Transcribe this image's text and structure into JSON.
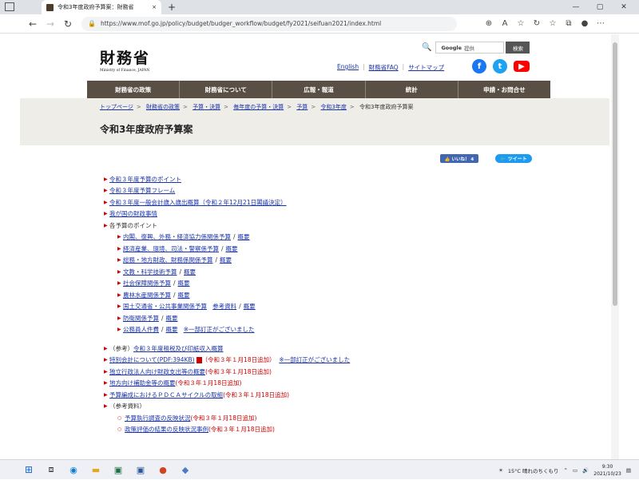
{
  "browser": {
    "tab_title": "令和3年度政府予算案：財務省",
    "tab_close": "×",
    "new_tab": "+",
    "url": "https://www.mof.go.jp/policy/budget/budger_workflow/budget/fy2021/seifuan2021/index.html",
    "minimize": "—",
    "maximize": "▢",
    "close": "✕"
  },
  "header": {
    "logo_jp": "財務省",
    "logo_en": "Ministry of Finance, JAPAN",
    "search_brand": "Google",
    "search_placeholder": "提供",
    "search_button": "検索",
    "util_links": [
      "English",
      "財務省FAQ",
      "サイトマップ"
    ],
    "util_sep": "|"
  },
  "main_nav": [
    "財務省の政策",
    "財務省について",
    "広報・報道",
    "統計",
    "申請・お問合せ"
  ],
  "breadcrumb": [
    "トップページ",
    "財務省の政策",
    "予算・決算",
    "毎年度の予算・決算",
    "予算",
    "令和3年度",
    "令和3年度政府予算案"
  ],
  "page_title": "令和3年度政府予算案",
  "sns": {
    "like": "👍 いいね！ 4",
    "tweet": "🐦 ツイート"
  },
  "links": {
    "top": [
      "令和３年度予算のポイント",
      "令和３年度予算フレーム",
      "令和３年度一般会計歳入歳出概算（令和２年12月21日閣議決定）",
      "我が国の財政事情"
    ],
    "points_heading": "各予算のポイント",
    "points": [
      {
        "main": "内閣、復興、外務・経済協力係関係予算",
        "summary": "概要"
      },
      {
        "main": "経済産業、環境、司法・警察係予算",
        "summary": "概要"
      },
      {
        "main": "総務・地方財政、財務係関係予算",
        "summary": "概要"
      },
      {
        "main": "文教・科学技術予算",
        "summary": "概要"
      },
      {
        "main": "社会保障関係予算",
        "summary": "概要"
      },
      {
        "main": "農林水産関係予算",
        "summary": "概要"
      },
      {
        "main": "国土交通省・公共事業関係予算",
        "extra": "参考資料",
        "summary": "概要"
      },
      {
        "main": "防衛関係予算",
        "summary": "概要"
      },
      {
        "main": "公務員人件費",
        "summary": "概要",
        "note": "※一部訂正がございました"
      }
    ],
    "sankou_prefix": "（参考）",
    "sankou_link": "令和３年度租税及び印紙収入概算",
    "tokubetsu": "特別会計について(PDF:394KB)",
    "added": "（令和３年１月18日追加）",
    "added_short": "(令和３年１月18日追加)",
    "correction": "※一部訂正がございました",
    "dokuhou": "独立行政法人向け財政支出等の概要",
    "chihou": "地方向け補助金等の概要",
    "pdca": "予算編成におけるＰＤＣＡサイクルの取組",
    "sankou_shiryou": "（参考資料）",
    "shiryou": [
      "予算執行調査の反映状況",
      "政策評価の結果の反映状況事例"
    ]
  },
  "taskbar": {
    "weather": "15°C  晴れのちくもり",
    "time": "9:30",
    "date": "2021/10/23"
  }
}
